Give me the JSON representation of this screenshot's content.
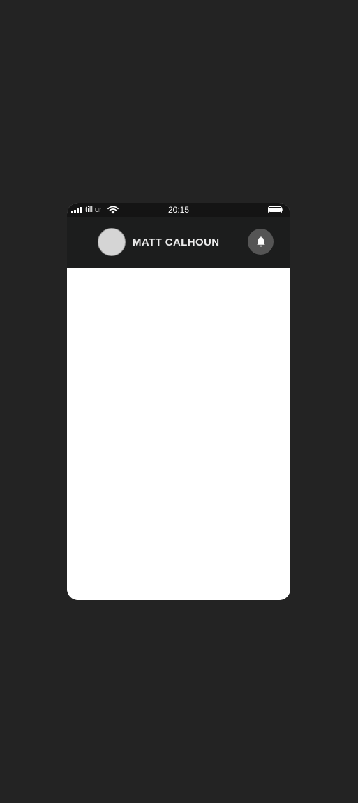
{
  "status_bar": {
    "carrier": "tilllur",
    "time": "20:15",
    "icons": [
      "signal-icon",
      "wifi-icon",
      "battery-icon"
    ]
  },
  "header": {
    "user_name": "MATT CALHOUN",
    "avatar": "avatar-placeholder",
    "notification_icon": "bell-icon"
  },
  "colors": {
    "page_background": "#232323",
    "header_background": "#1c1d1d",
    "status_bar_background": "#141414",
    "bell_button": "#555555",
    "avatar": "#d5d5d5",
    "content_background": "#ffffff"
  }
}
